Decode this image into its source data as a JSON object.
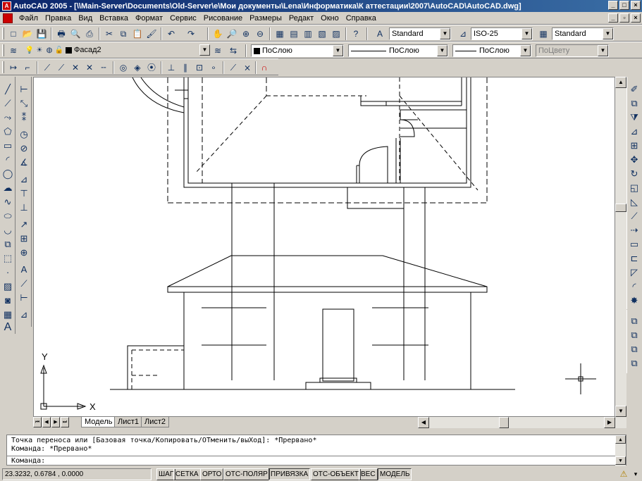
{
  "window": {
    "title": "AutoCAD 2005 - [\\\\Main-Server\\Documents\\Old-Server\\e\\Мои документы\\Lena\\Информатика\\К аттестации\\2007\\AutoCAD\\AutoCAD.dwg]",
    "controls": [
      "_",
      "□",
      "×"
    ]
  },
  "menu": {
    "items": [
      "Файл",
      "Правка",
      "Вид",
      "Вставка",
      "Формат",
      "Сервис",
      "Рисование",
      "Размеры",
      "Редакт",
      "Окно",
      "Справка"
    ],
    "doc_controls": [
      "_",
      "▫",
      "×"
    ]
  },
  "toolbar_std": {
    "text_style": "Standard",
    "dim_style": "ISO-25",
    "table_style": "Standard"
  },
  "layers": {
    "current_layer": "Фасад2",
    "color": "ПоСлою",
    "linetype": "ПоСлою",
    "lineweight": "ПоСлою",
    "plot_style": "ПоЦвету"
  },
  "drawing": {
    "ucs_x": "X",
    "ucs_y": "Y"
  },
  "tabs": {
    "nav": [
      "⏮",
      "◀",
      "▶",
      "⏭"
    ],
    "items": [
      "Модель",
      "Лист1",
      "Лист2"
    ]
  },
  "command": {
    "line1": "Точка переноса или [Базовая точка/Копировать/ОТменить/выХод]: *Прервано*",
    "line2": "Команда: *Прервано*",
    "prompt": "Команда:"
  },
  "status": {
    "coords": "23.3232, 0.6784 , 0.0000",
    "buttons": [
      "ШАГ",
      "СЕТКА",
      "ОРТО",
      "ОТС-ПОЛЯР",
      "ПРИВЯЗКА",
      "ОТС-ОБЪЕКТ",
      "ВЕС",
      "МОДЕЛЬ"
    ]
  },
  "colors": {
    "titlebar": "#0a246a",
    "chrome": "#d4d0c8",
    "canvas": "#ffffff"
  }
}
